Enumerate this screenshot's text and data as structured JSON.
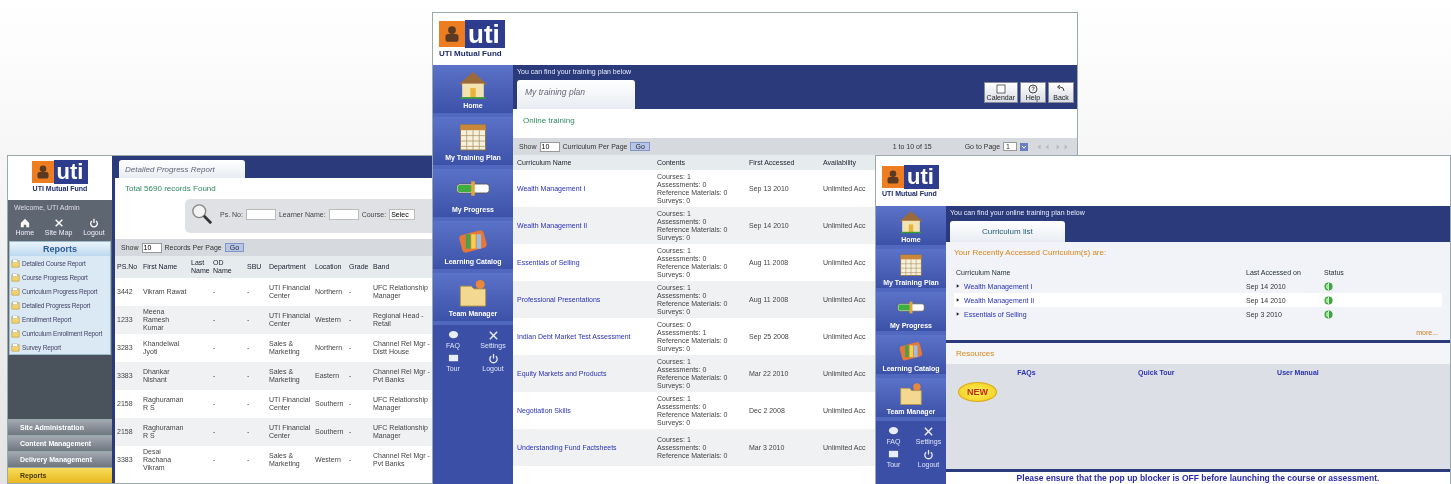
{
  "report_window": {
    "logo": {
      "brand": "uti",
      "name": "UTI Mutual Fund"
    },
    "welcome": "Welcome, UTI Admin",
    "quick_links": [
      {
        "label": "Home"
      },
      {
        "label": "Site Map"
      },
      {
        "label": "Logout"
      }
    ],
    "reports_menu": {
      "title": "Reports",
      "items": [
        "Detailed Course Report",
        "Course Progress Report",
        "Curriculum Progress Report",
        "Detailed Progress Report",
        "Enrollment Report",
        "Curriculum Enrollment Report",
        "Survey Report"
      ]
    },
    "sections": [
      {
        "label": "Site Administration",
        "selected": false
      },
      {
        "label": "Content Management",
        "selected": false
      },
      {
        "label": "Delivery Management",
        "selected": false
      },
      {
        "label": "Reports",
        "selected": true
      }
    ],
    "tab": "Detailed Progress Report",
    "total": "Total 5690 records Found",
    "search_fields": [
      {
        "label": "Ps. No:"
      },
      {
        "label": "Learner Name:"
      },
      {
        "label": "Course:",
        "value": "Selec"
      }
    ],
    "paging": {
      "show": "Show",
      "value": "10",
      "per_page": "Records Per Page",
      "go": "Go"
    },
    "columns": [
      "PS.No",
      "First Name",
      "Last Name",
      "OD Name",
      "SBU",
      "Department",
      "Location",
      "Grade",
      "Band"
    ],
    "rows": [
      [
        "3442",
        "Vikram Rawat",
        "",
        "-",
        "-",
        "UTI Financial Center",
        "Northern",
        "-",
        "UFC Relationship Manager"
      ],
      [
        "1233",
        "Meena Ramesh Kumar",
        "",
        "-",
        "-",
        "UTI Financial Center",
        "Western",
        "-",
        "Regional Head - Retail"
      ],
      [
        "3283",
        "Khandelwal Jyoti",
        "",
        "-",
        "-",
        "Sales & Marketing",
        "Northern",
        "-",
        "Channel Rel Mgr - Distt House"
      ],
      [
        "3383",
        "Dhankar Nishant",
        "",
        "-",
        "-",
        "Sales & Marketing",
        "Eastern",
        "-",
        "Channel Rel Mgr - Pvt Banks"
      ],
      [
        "2158",
        "Raghuraman R S",
        "",
        "-",
        "-",
        "UTI Financial Center",
        "Southern",
        "-",
        "UFC Relationship Manager"
      ],
      [
        "2158",
        "Raghuraman R S",
        "",
        "-",
        "-",
        "UTI Financial Center",
        "Southern",
        "-",
        "UFC Relationship Manager"
      ],
      [
        "3383",
        "Desai Rachana Vikram",
        "",
        "-",
        "-",
        "Sales & Marketing",
        "Western",
        "-",
        "Channel Rel Mgr - Pvt Banks"
      ]
    ]
  },
  "training_plan_window": {
    "logo": {
      "brand": "uti",
      "name": "UTI Mutual Fund"
    },
    "nav": [
      "Home",
      "My Training Plan",
      "My Progress",
      "Learning Catalog",
      "Team Manager"
    ],
    "small_links": [
      "FAQ",
      "Settings",
      "Tour",
      "Logout"
    ],
    "caption": "You can find your training plan below",
    "tab": "My training plan",
    "toolbar": [
      "Calendar",
      "Help",
      "Back"
    ],
    "subtitle": "Online training",
    "paging": {
      "show": "Show",
      "value": "10",
      "per_page": "Curriculum Per Page",
      "go": "Go",
      "range": "1 to 10 of 15",
      "goto": "Go to Page",
      "page": "1"
    },
    "columns": [
      "Curriculum Name",
      "Contents",
      "First Accessed",
      "Availability"
    ],
    "rows": [
      {
        "name": "Wealth Management I",
        "contents": [
          "Courses: 1",
          "Assessments: 0",
          "Reference Materials: 0",
          "Surveys: 0"
        ],
        "first_accessed": "Sep 13 2010",
        "availability": "Unlimited Acc"
      },
      {
        "name": "Wealth Management II",
        "contents": [
          "Courses: 1",
          "Assessments: 0",
          "Reference Materials: 0",
          "Surveys: 0"
        ],
        "first_accessed": "Sep 14 2010",
        "availability": "Unlimited Acc"
      },
      {
        "name": "Essentials of Selling",
        "contents": [
          "Courses: 1",
          "Assessments: 0",
          "Reference Materials: 0",
          "Surveys: 0"
        ],
        "first_accessed": "Aug 11 2008",
        "availability": "Unlimited Acc"
      },
      {
        "name": "Professional Presentations",
        "contents": [
          "Courses: 1",
          "Assessments: 0",
          "Reference Materials: 0",
          "Surveys: 0"
        ],
        "first_accessed": "Aug 11 2008",
        "availability": "Unlimited Acc"
      },
      {
        "name": "Indian Debt Market Test Assessment",
        "contents": [
          "Courses: 0",
          "Assessments: 1",
          "Reference Materials: 0",
          "Surveys: 0"
        ],
        "first_accessed": "Sep 25 2008",
        "availability": "Unlimited Acc"
      },
      {
        "name": "Equity Markets and Products",
        "contents": [
          "Courses: 1",
          "Assessments: 0",
          "Reference Materials: 0",
          "Surveys: 0"
        ],
        "first_accessed": "Mar 22 2010",
        "availability": "Unlimited Acc"
      },
      {
        "name": "Negotiation Skills",
        "contents": [
          "Courses: 1",
          "Assessments: 0",
          "Reference Materials: 0",
          "Surveys: 0"
        ],
        "first_accessed": "Dec 2 2008",
        "availability": "Unlimited Acc"
      },
      {
        "name": "Understanding Fund Factsheets",
        "contents": [
          "Courses: 1",
          "Assessments: 0",
          "Reference Materials: 0"
        ],
        "first_accessed": "Mar 3 2010",
        "availability": "Unlimited Acc"
      }
    ]
  },
  "curriculum_window": {
    "logo": {
      "brand": "uti",
      "name": "UTI Mutual Fund"
    },
    "nav": [
      "Home",
      "My Training Plan",
      "My Progress",
      "Learning Catalog",
      "Team Manager"
    ],
    "small_links": [
      "FAQ",
      "Settings",
      "Tour",
      "Logout"
    ],
    "caption": "You can find your online training plan below",
    "tab": "Curriculum list",
    "heading": "Your Recently Accessed Curriculum(s) are:",
    "columns": [
      "Curriculum Name",
      "Last Accessed on",
      "Status"
    ],
    "rows": [
      {
        "name": "Wealth Management I",
        "date": "Sep 14 2010"
      },
      {
        "name": "Wealth Management II",
        "date": "Sep 14 2010"
      },
      {
        "name": "Essentials of Selling",
        "date": "Sep 3 2010"
      }
    ],
    "more": "more...",
    "resources_title": "Resources",
    "resources": [
      "FAQs",
      "Quick Tour",
      "User Manual"
    ],
    "badge": "NEW",
    "notice": "Please ensure that the pop up blocker is OFF before launching the course or assessment."
  }
}
